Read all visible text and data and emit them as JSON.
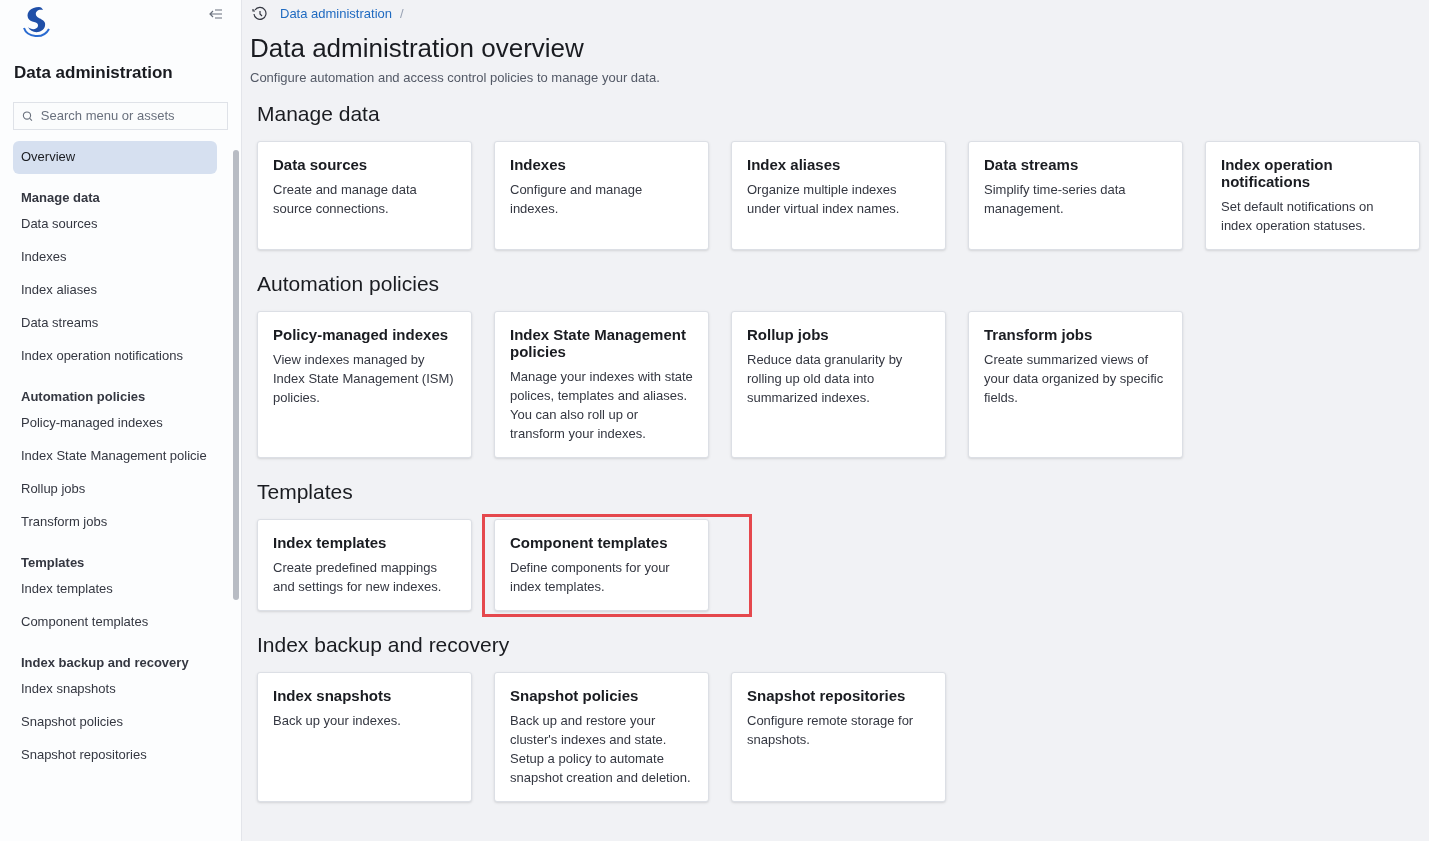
{
  "sidebar": {
    "title": "Data administration",
    "search": {
      "placeholder": "Search menu or assets"
    },
    "items": [
      {
        "label": "Overview",
        "selected": true
      }
    ],
    "groups": [
      {
        "title": "Manage data",
        "items": [
          {
            "label": "Data sources",
            "selected": false
          },
          {
            "label": "Indexes",
            "selected": false
          },
          {
            "label": "Index aliases",
            "selected": false
          },
          {
            "label": "Data streams",
            "selected": false
          },
          {
            "label": "Index operation notifications",
            "selected": false
          }
        ]
      },
      {
        "title": "Automation policies",
        "items": [
          {
            "label": "Policy-managed indexes",
            "selected": false
          },
          {
            "label": "Index State Management policie",
            "selected": false
          },
          {
            "label": "Rollup jobs",
            "selected": false
          },
          {
            "label": "Transform jobs",
            "selected": false
          }
        ]
      },
      {
        "title": "Templates",
        "items": [
          {
            "label": "Index templates",
            "selected": false
          },
          {
            "label": "Component templates",
            "selected": false
          }
        ]
      },
      {
        "title": "Index backup and recovery",
        "items": [
          {
            "label": "Index snapshots",
            "selected": false
          },
          {
            "label": "Snapshot policies",
            "selected": false
          },
          {
            "label": "Snapshot repositories",
            "selected": false
          }
        ]
      }
    ]
  },
  "breadcrumbs": [
    "Data administration",
    "/"
  ],
  "page": {
    "title": "Data administration overview",
    "subtitle": "Configure automation and access control policies to manage your data."
  },
  "sections": [
    {
      "title": "Manage data",
      "cards": [
        {
          "title": "Data sources",
          "description": "Create and manage data source connections.",
          "highlighted": false
        },
        {
          "title": "Indexes",
          "description": "Configure and manage indexes.",
          "highlighted": false
        },
        {
          "title": "Index aliases",
          "description": "Organize multiple indexes under virtual index names.",
          "highlighted": false
        },
        {
          "title": "Data streams",
          "description": "Simplify time-series data management.",
          "highlighted": false
        },
        {
          "title": "Index operation notifications",
          "description": "Set default notifications on index operation statuses.",
          "highlighted": false
        }
      ]
    },
    {
      "title": "Automation policies",
      "cards": [
        {
          "title": "Policy-managed indexes",
          "description": "View indexes managed by Index State Management (ISM) policies.",
          "highlighted": false
        },
        {
          "title": "Index State Management policies",
          "description": "Manage your indexes with state polices, templates and aliases. You can also roll up or transform your indexes.",
          "highlighted": false
        },
        {
          "title": "Rollup jobs",
          "description": "Reduce data granularity by rolling up old data into summarized indexes.",
          "highlighted": false
        },
        {
          "title": "Transform jobs",
          "description": "Create summarized views of your data organized by specific fields.",
          "highlighted": false
        }
      ]
    },
    {
      "title": "Templates",
      "cards": [
        {
          "title": "Index templates",
          "description": "Create predefined mappings and settings for new indexes.",
          "highlighted": false
        },
        {
          "title": "Component templates",
          "description": "Define components for your index templates.",
          "highlighted": true
        }
      ]
    },
    {
      "title": "Index backup and recovery",
      "cards": [
        {
          "title": "Index snapshots",
          "description": "Back up your indexes.",
          "highlighted": false
        },
        {
          "title": "Snapshot policies",
          "description": "Back up and restore your cluster's indexes and state. Setup a policy to automate snapshot creation and deletion.",
          "highlighted": false
        },
        {
          "title": "Snapshot repositories",
          "description": "Configure remote storage for snapshots.",
          "highlighted": false
        }
      ]
    }
  ]
}
